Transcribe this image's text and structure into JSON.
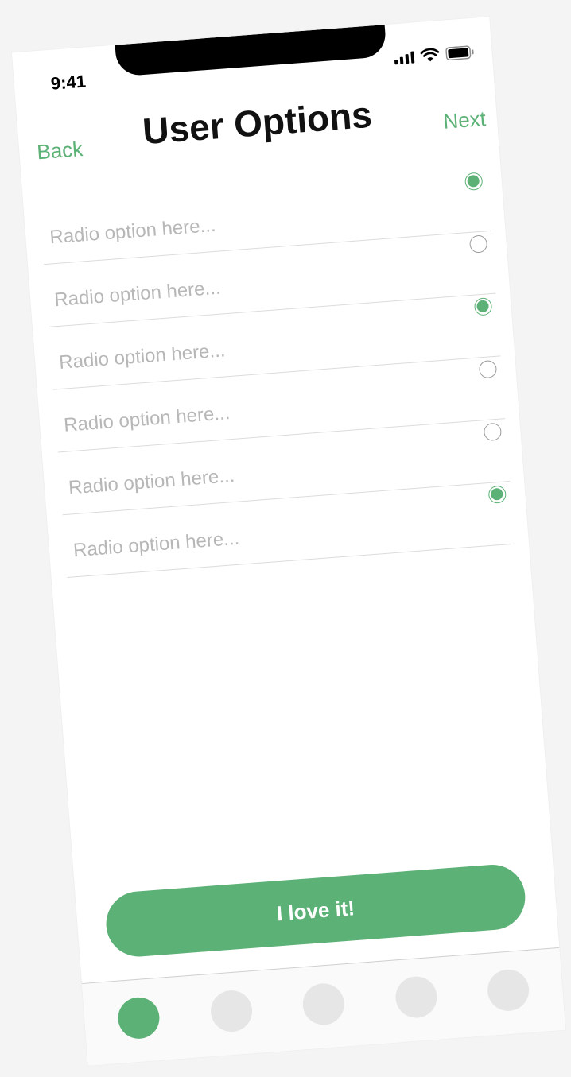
{
  "status_bar": {
    "time": "9:41",
    "icons": [
      "signal-icon",
      "wifi-icon",
      "battery-icon"
    ]
  },
  "nav": {
    "back_label": "Back",
    "title": "User Options",
    "next_label": "Next"
  },
  "options": [
    {
      "label": "Radio option here...",
      "checked": true
    },
    {
      "label": "Radio option here...",
      "checked": false
    },
    {
      "label": "Radio option here...",
      "checked": true
    },
    {
      "label": "Radio option here...",
      "checked": false
    },
    {
      "label": "Radio option here...",
      "checked": false
    },
    {
      "label": "Radio option here...",
      "checked": true
    }
  ],
  "cta": {
    "label": "I love it!"
  },
  "tabbar": {
    "tabs": [
      {
        "name": "tab-1",
        "active": true
      },
      {
        "name": "tab-2",
        "active": false
      },
      {
        "name": "tab-3",
        "active": false
      },
      {
        "name": "tab-4",
        "active": false
      },
      {
        "name": "tab-5",
        "active": false
      }
    ]
  },
  "colors": {
    "accent": "#5cb176",
    "placeholder_text": "#b7b7b7",
    "divider": "#dcdcdc",
    "inactive_tab": "#e6e6e6"
  }
}
